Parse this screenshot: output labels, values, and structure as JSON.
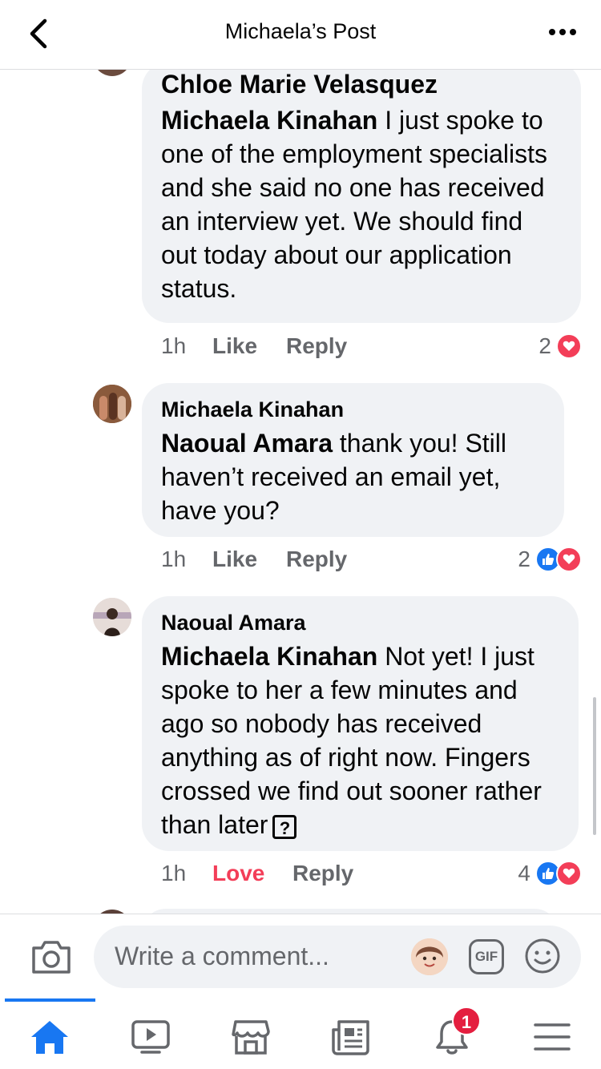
{
  "header": {
    "title": "Michaela’s Post",
    "back_icon": "chevron-left-icon",
    "more_icon": "more-dots-icon"
  },
  "comments": [
    {
      "author": "Chloe Marie Velasquez",
      "mention": "Michaela Kinahan",
      "text": " I just spoke to one of the employment specialists and she said no one has received an interview yet. We should find out today about our application status.",
      "time": "1h",
      "like_label": "Like",
      "reply_label": "Reply",
      "reaction_count": "2",
      "reactions": [
        "love"
      ]
    },
    {
      "author": "Michaela Kinahan",
      "mention": "Naoual Amara",
      "text": " thank you! Still haven’t received an email yet, have you?",
      "time": "1h",
      "like_label": "Like",
      "reply_label": "Reply",
      "reaction_count": "2",
      "reactions": [
        "like",
        "love"
      ]
    },
    {
      "author": "Naoual Amara",
      "mention": "Michaela Kinahan",
      "text": " Not yet! I just spoke to her a few minutes and ago so nobody has received anything as of right now. Fingers crossed we find out sooner rather than later",
      "unknown_char": "?",
      "time": "1h",
      "like_label": "Love",
      "reply_label": "Reply",
      "reaction_count": "4",
      "reactions": [
        "like",
        "love"
      ]
    }
  ],
  "composer": {
    "placeholder": "Write a comment...",
    "gif_label": "GIF",
    "camera_icon": "camera-icon",
    "emoji_icon": "smiley-icon"
  },
  "nav": {
    "tabs": [
      "home",
      "watch",
      "marketplace",
      "news",
      "notifications",
      "menu"
    ],
    "notifications_badge": "1"
  },
  "colors": {
    "accent": "#1877f2",
    "love": "#f33e58",
    "bubble": "#f0f2f5",
    "badge": "#e41e3f"
  }
}
